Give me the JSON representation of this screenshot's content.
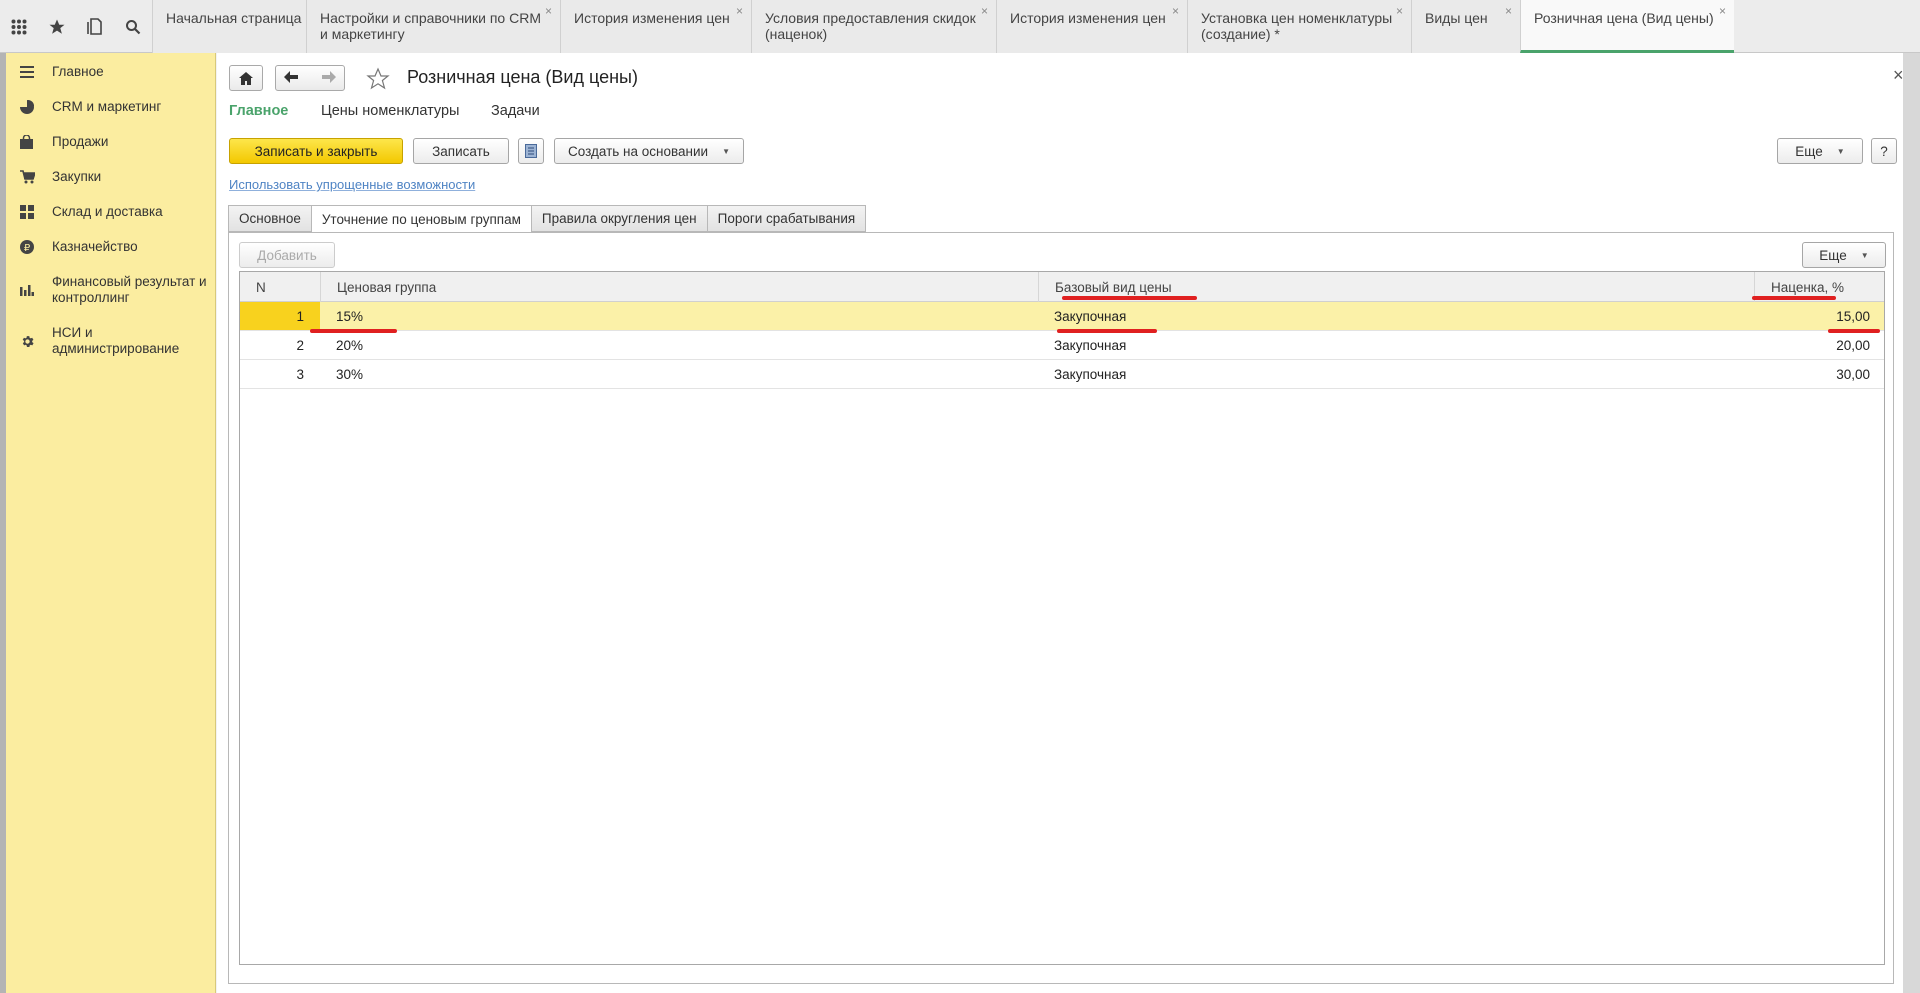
{
  "top_icons": [
    "apps-grid-icon",
    "star-icon",
    "history-icon",
    "search-icon"
  ],
  "tabs": [
    {
      "label": "Начальная страница",
      "closable": false
    },
    {
      "label": "Настройки и справочники по CRM\nи маркетингу",
      "closable": true
    },
    {
      "label": "История изменения цен",
      "closable": true
    },
    {
      "label": "Условия предоставления скидок\n(наценок)",
      "closable": true
    },
    {
      "label": "История изменения цен",
      "closable": true
    },
    {
      "label": "Установка цен номенклатуры\n(создание) *",
      "closable": true
    },
    {
      "label": "Виды цен",
      "closable": true
    },
    {
      "label": "Розничная цена (Вид цены)",
      "closable": true,
      "active": true
    }
  ],
  "sidebar": {
    "items": [
      {
        "label": "Главное",
        "icon": "menu-lines-icon"
      },
      {
        "label": "CRM и маркетинг",
        "icon": "pie-chart-icon"
      },
      {
        "label": "Продажи",
        "icon": "shopping-bag-icon"
      },
      {
        "label": "Закупки",
        "icon": "cart-icon"
      },
      {
        "label": "Склад и доставка",
        "icon": "warehouse-grid-icon"
      },
      {
        "label": "Казначейство",
        "icon": "ruble-coin-icon"
      },
      {
        "label": "Финансовый результат и контроллинг",
        "icon": "bar-chart-icon"
      },
      {
        "label": "НСИ и администрирование",
        "icon": "gear-icon"
      }
    ]
  },
  "form": {
    "title": "Розничная цена (Вид цены)",
    "close_glyph": "×",
    "nav_links": [
      "Главное",
      "Цены номенклатуры",
      "Задачи"
    ],
    "toolbar": {
      "save_close": "Записать и закрыть",
      "save": "Записать",
      "create_based": "Создать на основании",
      "more": "Еще",
      "help": "?"
    },
    "simplified_link": "Использовать упрощенные возможности",
    "form_tabs": [
      "Основное",
      "Уточнение по ценовым группам",
      "Правила округления цен",
      "Пороги срабатывания"
    ],
    "active_tab": 1
  },
  "table": {
    "add_button": "Добавить",
    "more_button": "Еще",
    "columns": [
      "N",
      "Ценовая группа",
      "Базовый вид цены",
      "Наценка, %"
    ],
    "rows": [
      {
        "n": "1",
        "group": "15%",
        "base": "Закупочная",
        "markup": "15,00",
        "selected": true
      },
      {
        "n": "2",
        "group": "20%",
        "base": "Закупочная",
        "markup": "20,00"
      },
      {
        "n": "3",
        "group": "30%",
        "base": "Закупочная",
        "markup": "30,00"
      }
    ]
  },
  "colors": {
    "accent_green": "#4aa36b",
    "sidebar_bg": "#fbeda0",
    "primary_button": "#f7d417",
    "selected_row": "#fbf1a8",
    "annotation_red": "#e02020"
  }
}
